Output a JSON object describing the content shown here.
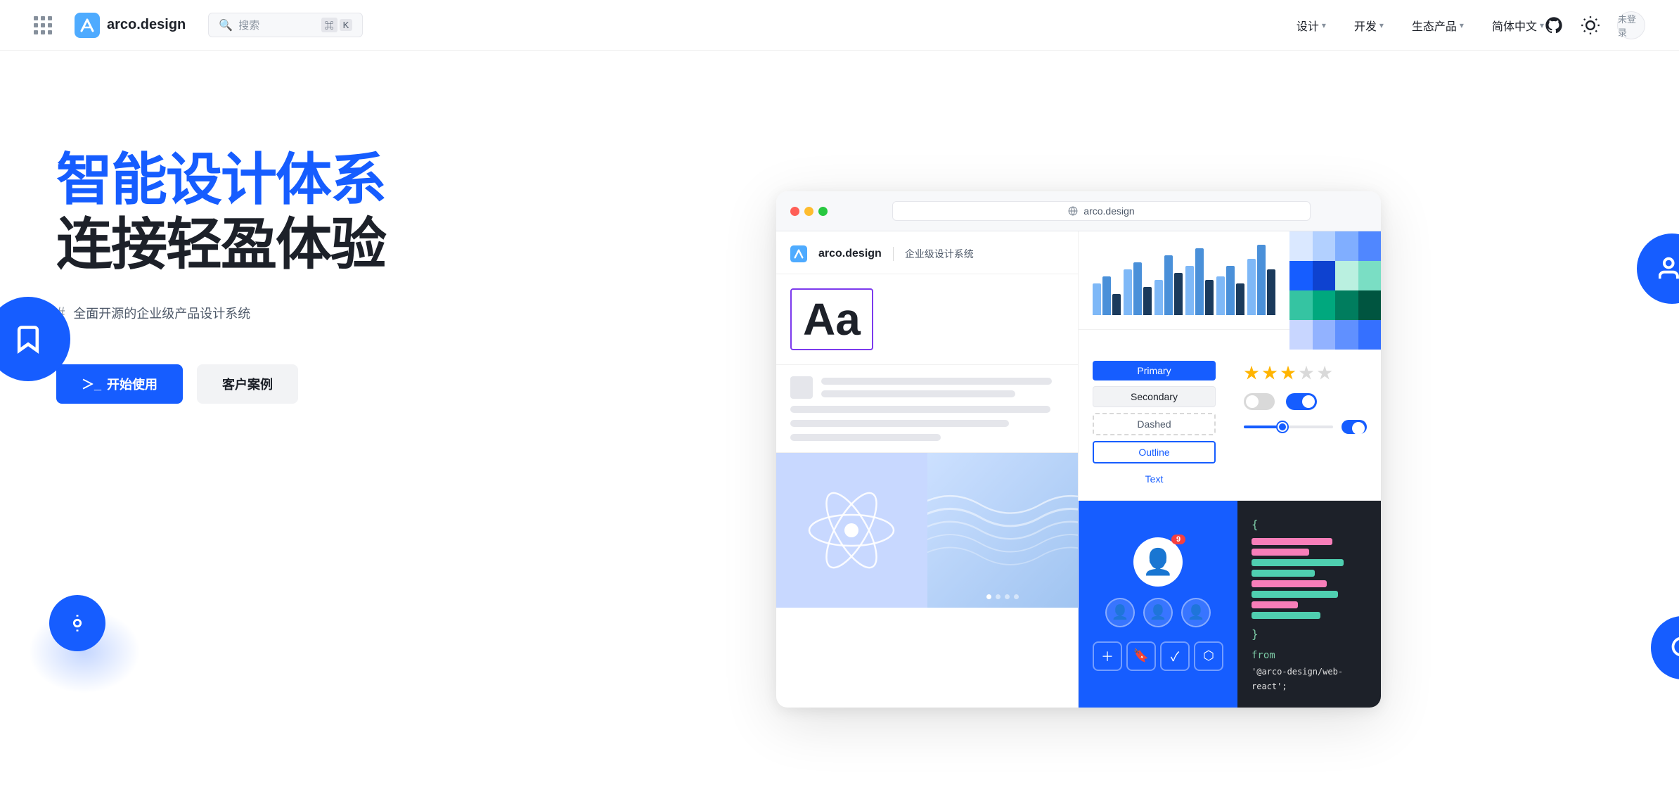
{
  "header": {
    "grid_label": "grid-menu",
    "logo_text": "arco.design",
    "search_placeholder": "搜索",
    "shortcut_cmd": "⌘",
    "shortcut_key": "K",
    "nav_items": [
      {
        "label": "设计",
        "id": "design"
      },
      {
        "label": "开发",
        "id": "dev"
      },
      {
        "label": "生态产品",
        "id": "ecosystem"
      },
      {
        "label": "简体中文",
        "id": "lang"
      }
    ],
    "login_text": "未登录"
  },
  "hero": {
    "title_colored": "智能设计体系",
    "title_dark": "连接轻盈体验",
    "desc_hash": "#",
    "desc_text": "全面开源的企业级产品设计系统",
    "btn_start": "开始使用",
    "btn_start_prefix": "＞_",
    "btn_cases": "客户案例"
  },
  "preview_card": {
    "url": "arco.design",
    "brand": "arco.design",
    "brand_sub": "企业级设计系统",
    "typo_preview": "Aa",
    "btn_labels": {
      "primary": "Primary",
      "secondary": "Secondary",
      "dashed": "Dashed",
      "outline": "Outline",
      "text": "Text"
    },
    "colors": [
      "#e8f0ff",
      "#c1d5ff",
      "#92b8ff",
      "#5e9bff",
      "#d5f0eb",
      "#a3dfd4",
      "#5eceba",
      "#18b5a0",
      "#b8daff",
      "#80bfff",
      "#4da6ff",
      "#1a8fff",
      "#d1eecc",
      "#9ad491",
      "#63bb59",
      "#33a427"
    ],
    "stars": [
      true,
      true,
      true,
      false,
      false
    ],
    "badge_count": "9",
    "code_lines": [
      {
        "color": "#f77eb9",
        "width": "70%"
      },
      {
        "color": "#f77eb9",
        "width": "55%"
      },
      {
        "color": "#4fcfb0",
        "width": "80%"
      },
      {
        "color": "#4fcfb0",
        "width": "45%"
      },
      {
        "color": "#4fcfb0",
        "width": "60%"
      }
    ],
    "code_from": "from",
    "code_import_str": "'@arco-design/web-react';"
  }
}
